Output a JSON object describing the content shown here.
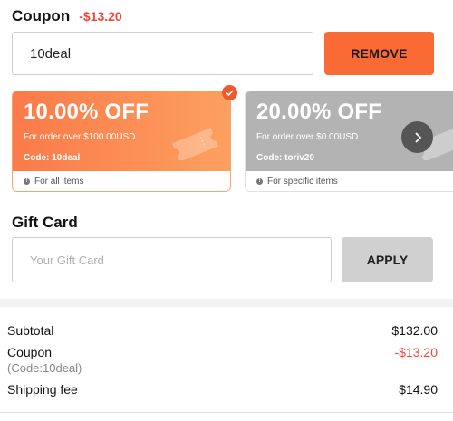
{
  "coupon": {
    "title": "Coupon",
    "discount": "-$13.20",
    "input_value": "10deal",
    "remove_label": "REMOVE"
  },
  "coupon_cards": [
    {
      "percent": "10.00% OFF",
      "condition": "For order over $100.00USD",
      "code": "Code: 10deal",
      "scope": "For all items",
      "selected": true,
      "color": "#fb7a49"
    },
    {
      "percent": "20.00% OFF",
      "condition": "For order over $0.00USD",
      "code": "Code: toriv20",
      "scope": "For specific items",
      "selected": false,
      "color": "#b3b3b3"
    }
  ],
  "gift_card": {
    "title": "Gift Card",
    "placeholder": "Your Gift Card",
    "apply_label": "APPLY"
  },
  "summary": {
    "subtotal_label": "Subtotal",
    "subtotal_value": "$132.00",
    "coupon_label": "Coupon",
    "coupon_sub": "(Code:10deal)",
    "coupon_value": "-$13.20",
    "shipping_label": "Shipping fee",
    "shipping_value": "$14.90"
  },
  "icons": {
    "selected": "check-icon",
    "carousel_next": "chevron-right-icon",
    "info": "info-icon",
    "ticket": "ticket-icon"
  },
  "colors": {
    "accent": "#fa6a34",
    "negative": "#f0453a",
    "disabled_button": "#d0d0d0"
  }
}
